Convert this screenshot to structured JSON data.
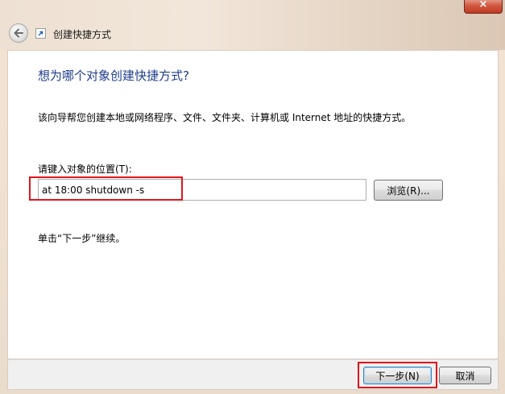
{
  "window": {
    "title": "创建快捷方式",
    "close_glyph": "×"
  },
  "icons": {
    "back": "back-arrow-icon",
    "app": "shortcut-icon",
    "close": "close-icon"
  },
  "main": {
    "heading": "想为哪个对象创建快捷方式?",
    "description": "该向导帮您创建本地或网络程序、文件、文件夹、计算机或 Internet 地址的快捷方式。",
    "location_label": "请键入对象的位置(T):",
    "location_value": "at 18:00 shutdown -s",
    "browse_label": "浏览(R)...",
    "hint": "单击“下一步”继续。"
  },
  "footer": {
    "next_label": "下一步(N)",
    "cancel_label": "取消"
  },
  "colors": {
    "heading": "#1e3c8c",
    "highlight": "#e0151c"
  }
}
